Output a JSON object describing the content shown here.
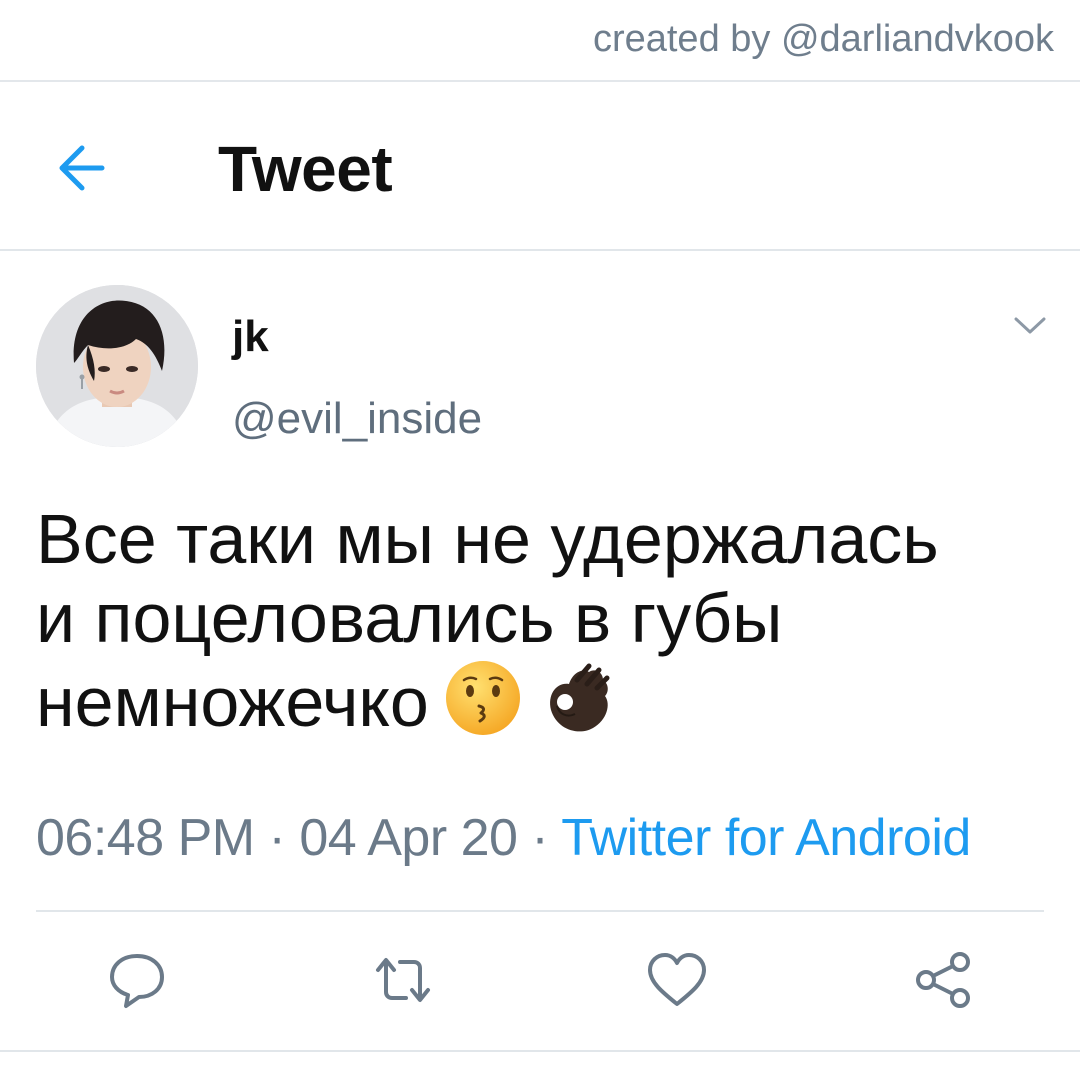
{
  "credit": "created by @darliandvkook",
  "header": {
    "title": "Tweet",
    "back_icon": "arrow-left-icon",
    "accent": "#1d9bf0"
  },
  "tweet": {
    "display_name": "jk",
    "handle": "@evil_inside",
    "text_lines": [
      "Все таки мы не удержалась",
      "и поцеловались в губы",
      "немножечко"
    ],
    "emojis": [
      "kissing-face-emoji",
      "ok-hand-dark-skin-emoji"
    ],
    "time": "06:48 PM",
    "date": "04 Apr 20",
    "separator": "·",
    "source": "Twitter for Android"
  },
  "actions": [
    {
      "name": "reply",
      "icon": "reply-icon"
    },
    {
      "name": "retweet",
      "icon": "retweet-icon"
    },
    {
      "name": "like",
      "icon": "heart-icon"
    },
    {
      "name": "share",
      "icon": "share-icon"
    }
  ],
  "colors": {
    "text": "#111111",
    "secondary": "#5f6e7d",
    "link": "#1d9bf0",
    "divider": "#e1e6ea"
  }
}
